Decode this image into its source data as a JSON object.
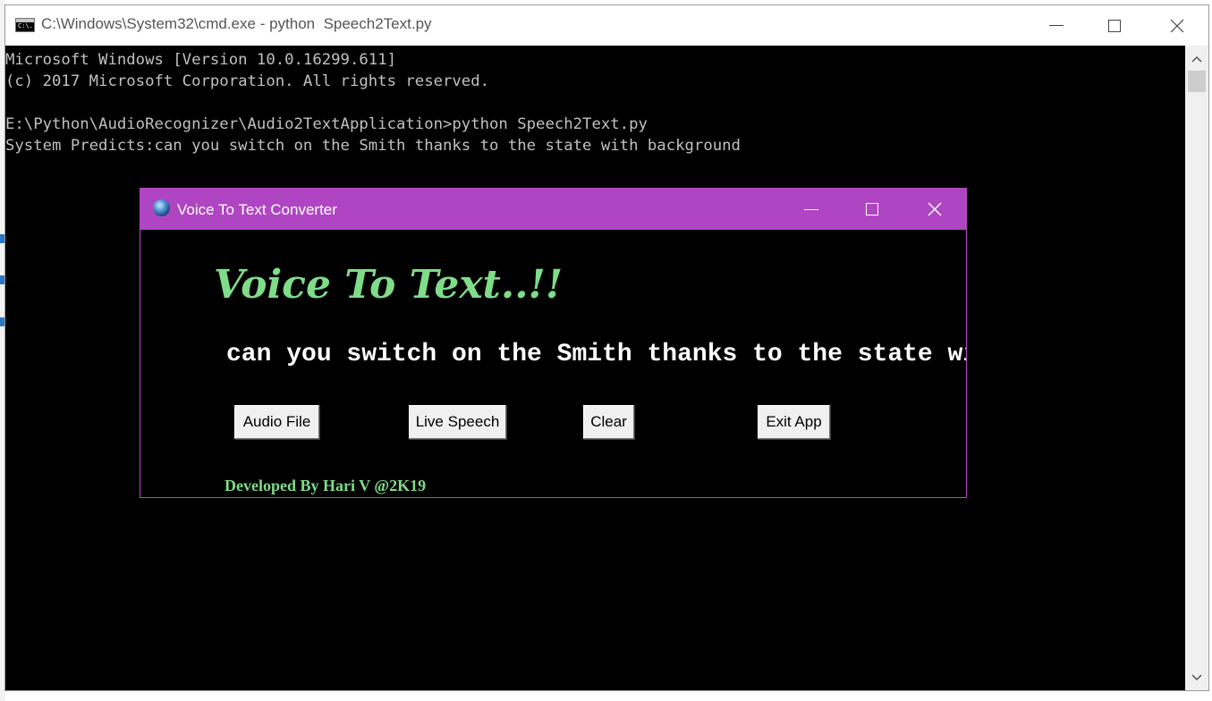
{
  "cmd": {
    "title": "C:\\Windows\\System32\\cmd.exe - python  Speech2Text.py",
    "icon_text": "C:\\.",
    "lines": [
      "Microsoft Windows [Version 10.0.16299.611]",
      "(c) 2017 Microsoft Corporation. All rights reserved.",
      "",
      "E:\\Python\\AudioRecognizer\\Audio2TextApplication>python Speech2Text.py",
      "System Predicts:can you switch on the Smith thanks to the state with background"
    ]
  },
  "vtt": {
    "title": "Voice To Text Converter",
    "heading": "Voice To Text..!!",
    "result": "can you switch on the Smith thanks to the state with background",
    "buttons": {
      "audio_file": "Audio File",
      "live_speech": "Live Speech",
      "clear": "Clear",
      "exit_app": "Exit App"
    },
    "footer": "Developed By Hari V @2K19"
  },
  "colors": {
    "titlebar_accent": "#af45c2",
    "heading_green": "#7fdc88",
    "console_bg": "#000000",
    "console_text": "#c0c0c0"
  },
  "icons": [
    "cmd-app-icon",
    "globe-icon",
    "minimize-icon",
    "maximize-icon",
    "close-icon",
    "scroll-up-icon",
    "scroll-down-icon"
  ]
}
